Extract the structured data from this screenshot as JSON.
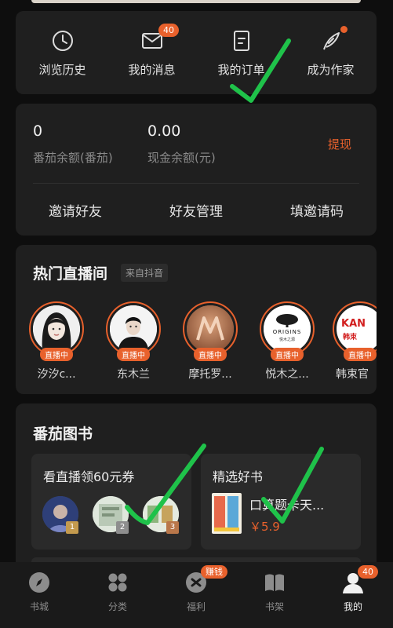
{
  "quick_actions": [
    {
      "label": "浏览历史",
      "icon": "clock-icon"
    },
    {
      "label": "我的消息",
      "icon": "mail-icon",
      "badge": "40"
    },
    {
      "label": "我的订单",
      "icon": "order-icon"
    },
    {
      "label": "成为作家",
      "icon": "quill-icon",
      "dot": true
    }
  ],
  "wallet": {
    "tomato_balance": "0",
    "tomato_label": "番茄余额(番茄)",
    "cash_balance": "0.00",
    "cash_label": "现金余额(元)",
    "withdraw": "提现",
    "actions": [
      "邀请好友",
      "好友管理",
      "填邀请码"
    ]
  },
  "live": {
    "title": "热门直播间",
    "source": "来自抖音",
    "live_label": "直播中",
    "streamers": [
      {
        "name": "汐汐c..."
      },
      {
        "name": "东木兰"
      },
      {
        "name": "摩托罗..."
      },
      {
        "name": "悦木之..."
      },
      {
        "name": "韩束官"
      }
    ],
    "logo_text": "ORIGINS",
    "logo_sub": "悦木之源",
    "kans_text": "KAN",
    "kans_sub": "韩束"
  },
  "books": {
    "title": "番茄图书",
    "live_coupon": {
      "title": "看直播领60元券",
      "ranks": [
        "1",
        "2",
        "3"
      ]
    },
    "featured": {
      "title": "精选好书",
      "book_name": "口算题卡天...",
      "price": "￥5.9"
    }
  },
  "tabbar": {
    "tabs": [
      {
        "label": "书城",
        "icon": "compass-icon"
      },
      {
        "label": "分类",
        "icon": "grid-icon"
      },
      {
        "label": "福利",
        "icon": "gift-icon",
        "badge": "赚钱"
      },
      {
        "label": "书架",
        "icon": "book-icon"
      },
      {
        "label": "我的",
        "icon": "user-icon",
        "badge": "40",
        "active": true
      }
    ]
  },
  "colors": {
    "accent": "#e8612c",
    "check": "#1fc24a",
    "card": "#1f1f1f",
    "background": "#0e0e0e"
  }
}
